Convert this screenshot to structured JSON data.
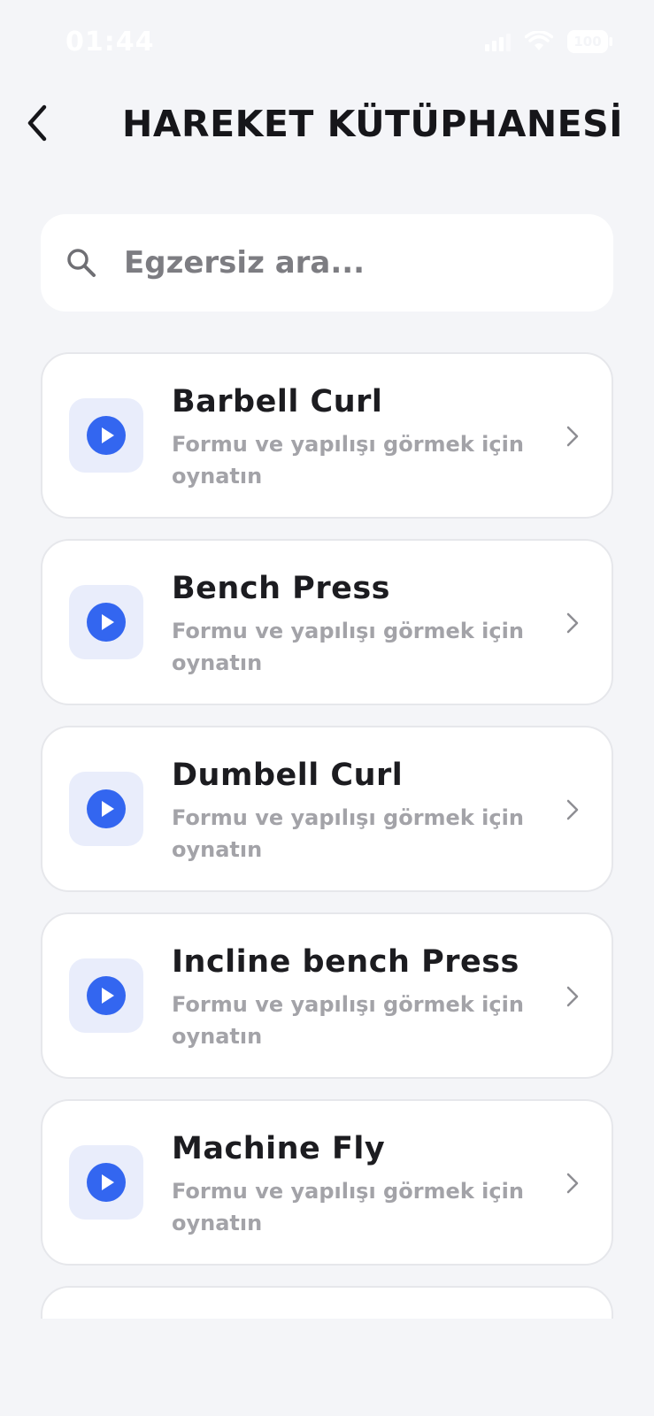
{
  "status_bar": {
    "time": "01:44",
    "battery": "100",
    "icons": [
      "signal-icon",
      "wifi-icon",
      "battery-icon"
    ]
  },
  "header": {
    "title": "HAREKET KÜTÜPHANESİ",
    "back_icon": "chevron-left-icon"
  },
  "search": {
    "placeholder": "Egzersiz ara...",
    "value": "",
    "icon": "search-icon"
  },
  "exercises": [
    {
      "title": "Barbell Curl",
      "subtitle": "Formu ve yapılışı görmek için oynatın"
    },
    {
      "title": "Bench Press",
      "subtitle": "Formu ve yapılışı görmek için oynatın"
    },
    {
      "title": "Dumbell Curl",
      "subtitle": "Formu ve yapılışı görmek için oynatın"
    },
    {
      "title": "Incline bench Press",
      "subtitle": "Formu ve yapılışı görmek için oynatın"
    },
    {
      "title": "Machine Fly",
      "subtitle": "Formu ve yapılışı görmek için oynatın"
    }
  ],
  "colors": {
    "accent": "#3366f0",
    "tile_bg": "#e9edfb",
    "background": "#f4f5f8",
    "subtitle": "#a3a3a8"
  }
}
